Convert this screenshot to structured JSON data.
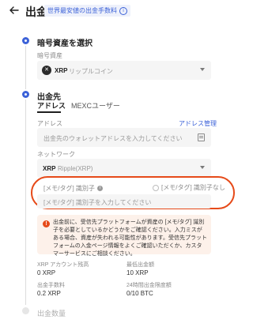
{
  "header": {
    "title": "出金",
    "fee_badge": "世界最安値の出金手数料"
  },
  "step1": {
    "title": "暗号資産を選択",
    "field_label": "暗号資産",
    "coin_symbol": "XRP",
    "coin_name": "リップルコイン"
  },
  "step2": {
    "title": "出金先",
    "tabs": [
      {
        "label": "アドレス",
        "active": true
      },
      {
        "label": "MEXCユーザー",
        "active": false
      }
    ],
    "address_label": "アドレス",
    "address_mgmt": "アドレス管理",
    "address_placeholder": "出金先のウォレットアドレスを入力してください",
    "network_label": "ネットワーク",
    "network_symbol": "XRP",
    "network_name": "Ripple(XRP)",
    "memo_label": "[メモ/タグ] 識別子",
    "memo_none_label": "[メモ/タグ] 識別子なし",
    "memo_placeholder": "[メモ/タグ] 識別子を入力してください",
    "warning": "出金前に、受信先プラットフォームが資産の [メモ/タグ] 識別子を必要としているかどうかをご確認ください。入力ミスがある場合、資産が失われる可能性があります。受信先プラットフォームの入金ページ情報をよくご確認いただくか、カスタマーサービスにご相談ください。"
  },
  "info": {
    "account_balance_label": "XRP アカウント残高",
    "account_balance_value": "0 XRP",
    "min_withdraw_label": "最低出金額",
    "min_withdraw_value": "10 XRP",
    "fee_label": "出金手数料",
    "fee_value": "0.2 XRP",
    "limit_label": "24時間出金限度額",
    "limit_value": "0/10 BTC"
  },
  "step3": {
    "title": "出金数量"
  },
  "colors": {
    "accent": "#3c62d8",
    "warning": "#e64a19",
    "warning_bg": "#fdf1ea"
  }
}
